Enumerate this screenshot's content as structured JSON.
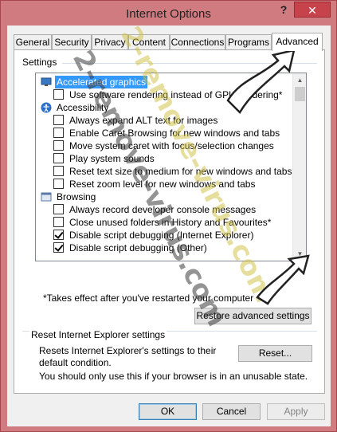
{
  "window": {
    "title": "Internet Options",
    "help_label": "?",
    "close_label": "✕"
  },
  "tabs": [
    {
      "label": "General"
    },
    {
      "label": "Security"
    },
    {
      "label": "Privacy"
    },
    {
      "label": "Content"
    },
    {
      "label": "Connections"
    },
    {
      "label": "Programs"
    },
    {
      "label": "Advanced",
      "active": true
    }
  ],
  "settings": {
    "group_label": "Settings",
    "items": [
      {
        "type": "category",
        "label": "Accelerated graphics",
        "icon": "monitor-icon",
        "selected": true
      },
      {
        "type": "checkbox",
        "label": "Use software rendering instead of GPU rendering*",
        "checked": false
      },
      {
        "type": "category",
        "label": "Accessibility",
        "icon": "accessibility-icon"
      },
      {
        "type": "checkbox",
        "label": "Always expand ALT text for images",
        "checked": false
      },
      {
        "type": "checkbox",
        "label": "Enable Caret Browsing for new windows and tabs",
        "checked": false
      },
      {
        "type": "checkbox",
        "label": "Move system caret with focus/selection changes",
        "checked": false
      },
      {
        "type": "checkbox",
        "label": "Play system sounds",
        "checked": false
      },
      {
        "type": "checkbox",
        "label": "Reset text size to medium for new windows and tabs",
        "checked": false
      },
      {
        "type": "checkbox",
        "label": "Reset zoom level for new windows and tabs",
        "checked": false
      },
      {
        "type": "category",
        "label": "Browsing",
        "icon": "browsing-icon"
      },
      {
        "type": "checkbox",
        "label": "Always record developer console messages",
        "checked": false
      },
      {
        "type": "checkbox",
        "label": "Close unused folders in History and Favourites*",
        "checked": false
      },
      {
        "type": "checkbox",
        "label": "Disable script debugging (Internet Explorer)",
        "checked": true
      },
      {
        "type": "checkbox",
        "label": "Disable script debugging (Other)",
        "checked": true
      }
    ],
    "footnote": "*Takes effect after you've restarted your computer",
    "restore_button": "Restore advanced settings"
  },
  "reset": {
    "group_label": "Reset Internet Explorer settings",
    "description": "Resets Internet Explorer's settings to their default condition.",
    "reset_button": "Reset...",
    "warning": "You should only use this if your browser is in an unusable state."
  },
  "footer": {
    "ok": "OK",
    "cancel": "Cancel",
    "apply": "Apply"
  },
  "watermark": {
    "line1": "2-remove-virus.com",
    "line2": "2-remove-virus.com"
  }
}
